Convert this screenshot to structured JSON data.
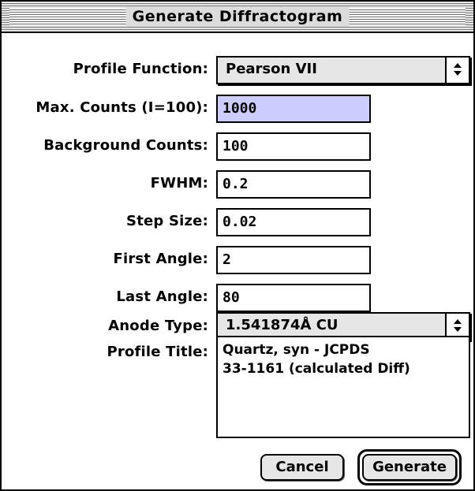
{
  "window": {
    "title": "Generate Diffractogram"
  },
  "form": {
    "profile_function": {
      "label": "Profile Function:",
      "value": "Pearson VII"
    },
    "max_counts": {
      "label": "Max. Counts (I=100):",
      "value": "1000"
    },
    "background_counts": {
      "label": "Background Counts:",
      "value": "100"
    },
    "fwhm": {
      "label": "FWHM:",
      "value": "0.2"
    },
    "step_size": {
      "label": "Step Size:",
      "value": "0.02"
    },
    "first_angle": {
      "label": "First Angle:",
      "value": "2"
    },
    "last_angle": {
      "label": "Last Angle:",
      "value": "80"
    },
    "anode_type": {
      "label": "Anode Type:",
      "value": "1.541874Å CU"
    },
    "profile_title": {
      "label": "Profile Title:",
      "value": "Quartz, syn - JCPDS\n33-1161 (calculated Diff)"
    }
  },
  "buttons": {
    "cancel": "Cancel",
    "generate": "Generate"
  },
  "icons": {
    "popup_arrows": "up-down-arrows-icon"
  },
  "colors": {
    "highlight": "#ccccff",
    "button_face": "#e6e6e6"
  }
}
